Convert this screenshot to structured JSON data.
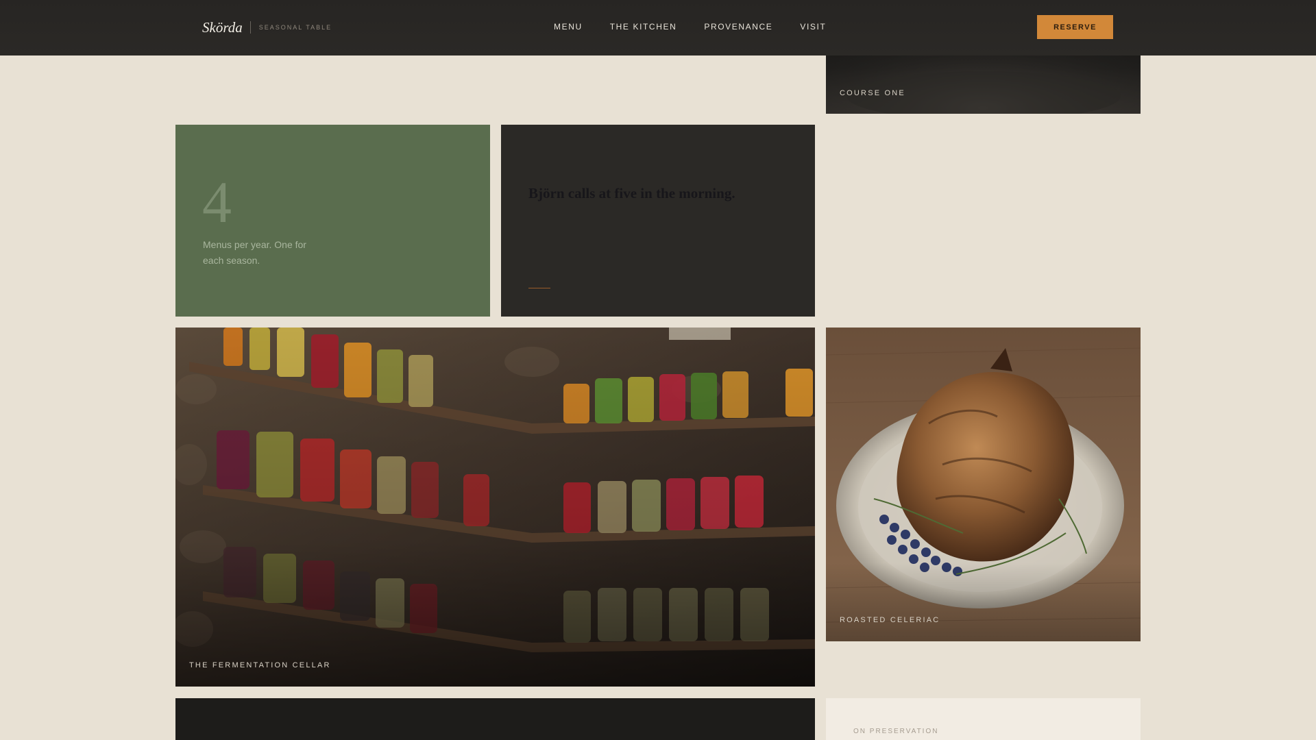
{
  "header": {
    "brand_name": "Skörda",
    "brand_tagline": "SEASONAL TABLE",
    "nav": [
      "MENU",
      "THE KITCHEN",
      "PROVENANCE",
      "VISIT"
    ],
    "reserve_label": "RESERVE"
  },
  "tiles": {
    "course": {
      "caption": "COURSE ONE"
    },
    "stat": {
      "number": "4",
      "text": "Menus per year. One for each season."
    },
    "story": {
      "eyebrow": "",
      "title": "Björn calls at five in the morning.",
      "body": ""
    },
    "cellar": {
      "caption": "THE FERMENTATION CELLAR"
    },
    "celeriac": {
      "caption": "ROASTED CELERIAC"
    },
    "preservation": {
      "eyebrow": "ON PRESERVATION"
    }
  },
  "colors": {
    "page_background": "#e8e1d4",
    "header_background": "#272523",
    "accent": "#d28839",
    "moss_green": "#5a6d4e",
    "charcoal": "#2b2926"
  }
}
